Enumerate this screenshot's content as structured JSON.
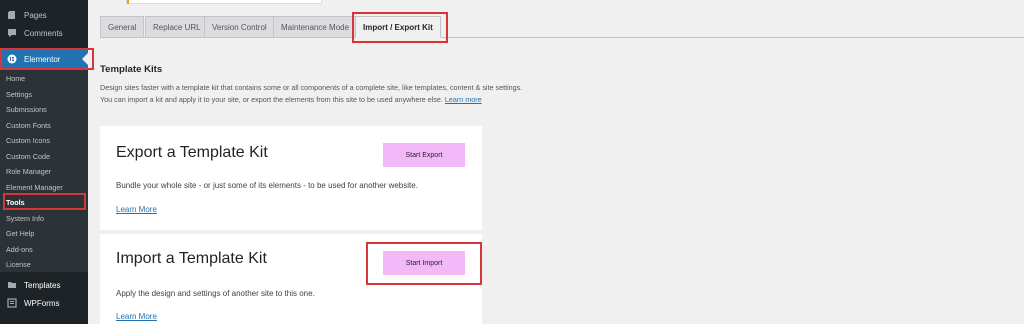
{
  "sidebar": {
    "top_items": [
      {
        "label": "Pages",
        "icon": "pages-icon"
      },
      {
        "label": "Comments",
        "icon": "comments-icon"
      }
    ],
    "active": {
      "label": "Elementor",
      "icon": "elementor-icon"
    },
    "submenu": [
      "Home",
      "Settings",
      "Submissions",
      "Custom Fonts",
      "Custom Icons",
      "Custom Code",
      "Role Manager",
      "Element Manager",
      "Tools",
      "System Info",
      "Get Help",
      "Add-ons",
      "License"
    ],
    "current_submenu": "Tools",
    "bottom_items": [
      {
        "label": "Templates",
        "icon": "folder-icon"
      },
      {
        "label": "WPForms",
        "icon": "wpforms-icon"
      }
    ]
  },
  "tabs": [
    "General",
    "Replace URL",
    "Version Control",
    "Maintenance Mode",
    "Import / Export Kit"
  ],
  "active_tab": "Import / Export Kit",
  "section": {
    "title": "Template Kits",
    "desc_line1": "Design sites faster with a template kit that contains some or all components of a complete site, like templates, content & site settings.",
    "desc_line2": "You can import a kit and apply it to your site, or export the elements from this site to be used anywhere else.",
    "learn_more": "Learn more"
  },
  "export_card": {
    "title": "Export a Template Kit",
    "text": "Bundle your whole site - or just some of its elements - to be used for another website.",
    "link": "Learn More",
    "button": "Start Export"
  },
  "import_card": {
    "title": "Import a Template Kit",
    "text": "Apply the design and settings of another site to this one.",
    "link": "Learn More",
    "button": "Start Import"
  },
  "colors": {
    "sidebar_bg": "#1d2327",
    "active_blue": "#2271b1",
    "highlight_red": "#d63638",
    "button_pink": "#f3b8f8"
  }
}
